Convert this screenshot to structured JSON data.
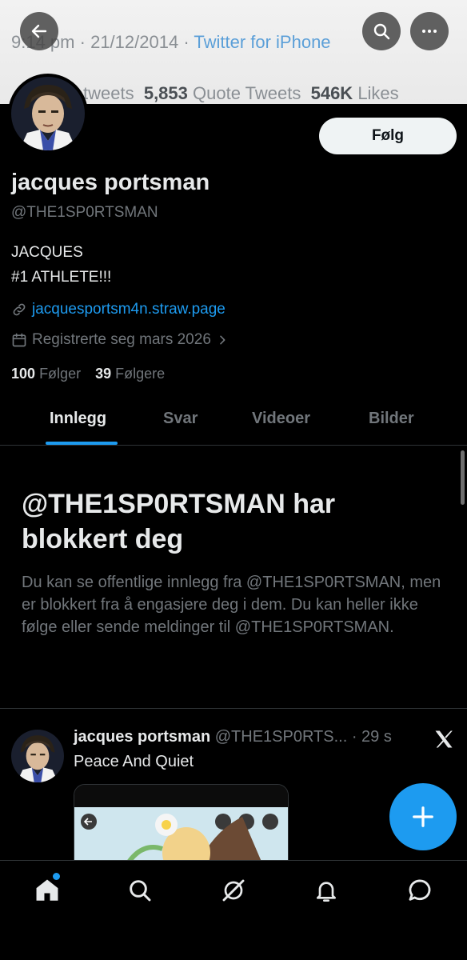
{
  "banner": {
    "time": "9:14 pm",
    "sep": "·",
    "date": "21/12/2014",
    "source": "Twitter for iPhone",
    "stats_partial": "tweets",
    "quote_count": "5,853",
    "quote_label": "Quote Tweets",
    "likes_count": "546K",
    "likes_label": "Likes"
  },
  "profile": {
    "name": "jacques portsman",
    "handle": "@THE1SP0RTSMAN",
    "bio_line1": "JACQUES",
    "bio_line2": "#1 ATHLETE!!!",
    "link": "jacquesportsm4n.straw.page",
    "joined": "Registrerte seg mars 2026",
    "following_count": "100",
    "following_label": "Følger",
    "followers_count": "39",
    "followers_label": "Følgere",
    "follow_button": "Følg"
  },
  "tabs": [
    {
      "label": "Innlegg",
      "active": true
    },
    {
      "label": "Svar",
      "active": false
    },
    {
      "label": "Videoer",
      "active": false
    },
    {
      "label": "Bilder",
      "active": false
    }
  ],
  "blocked": {
    "title": "@THE1SP0RTSMAN har blokkert deg",
    "body": "Du kan se offentlige innlegg fra @THE1SP0RTSMAN, men er blokkert fra å engasjere deg i dem. Du kan heller ikke følge eller sende meldinger til @THE1SP0RTSMAN."
  },
  "post": {
    "name": "jacques portsman",
    "handle": "@THE1SP0RTS...",
    "time": "· 29 s",
    "text": "Peace And Quiet"
  },
  "icons": {
    "back": "arrow-left-icon",
    "search": "search-icon",
    "more": "more-horizontal-icon",
    "link": "link-icon",
    "calendar": "calendar-icon",
    "chevron": "chevron-right-icon",
    "x_logo": "x-logo-icon",
    "compose": "plus-icon",
    "nav": [
      "home-icon",
      "search-icon",
      "grok-icon",
      "bell-icon",
      "messages-icon"
    ]
  },
  "colors": {
    "background": "#000000",
    "accent": "#1d9bf0",
    "primary_text": "#e7e9ea",
    "secondary_text": "#71767b"
  }
}
